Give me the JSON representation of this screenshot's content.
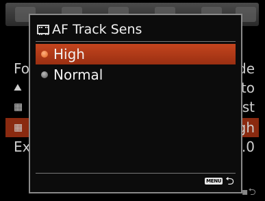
{
  "background_menu": {
    "rows": [
      {
        "left": "Fo",
        "right": "de"
      },
      {
        "left": "",
        "right": "uto"
      },
      {
        "left": "",
        "right": "ast"
      },
      {
        "left": "",
        "right": "gh"
      },
      {
        "left": "Ex",
        "right": "0.0"
      }
    ]
  },
  "dialog": {
    "title": "AF Track Sens",
    "options": [
      {
        "label": "High",
        "selected": true
      },
      {
        "label": "Normal",
        "selected": false
      }
    ],
    "menu_badge": "MENU",
    "back_symbol": "⮌"
  },
  "colors": {
    "selection": "#b83c18",
    "background": "#000000"
  }
}
